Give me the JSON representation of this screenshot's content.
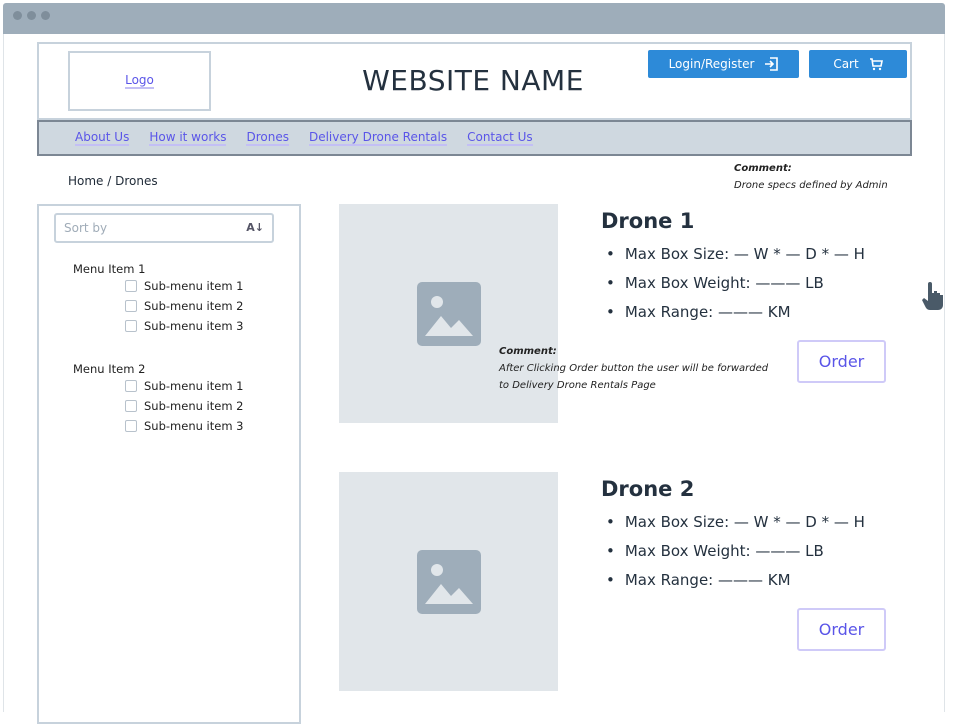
{
  "header": {
    "logo": "Logo",
    "site_name": "WEBSITE NAME",
    "login_label": "Login/Register",
    "cart_label": "Cart"
  },
  "nav": [
    "About Us",
    "How it works",
    "Drones",
    "Delivery Drone Rentals",
    "Contact Us"
  ],
  "breadcrumb": "Home / Drones",
  "comments": [
    {
      "title": "Comment:",
      "text": "Drone specs defined by Admin"
    },
    {
      "title": "Comment:",
      "line1": "After Clicking Order button the user will be forwarded",
      "line2": "to Delivery Drone Rentals Page"
    }
  ],
  "sidebar": {
    "sort_placeholder": "Sort by",
    "menus": [
      {
        "label": "Menu Item 1",
        "subs": [
          "Sub-menu item 1",
          "Sub-menu item 2",
          "Sub-menu item 3"
        ]
      },
      {
        "label": "Menu Item 2",
        "subs": [
          "Sub-menu item 1",
          "Sub-menu item 2",
          "Sub-menu item 3"
        ]
      }
    ]
  },
  "drones": [
    {
      "title": "Drone 1",
      "specs": [
        "Max Box Size: — W * — D * — H",
        "Max Box Weight: ——— LB",
        "Max Range: ——— KM"
      ],
      "order": "Order"
    },
    {
      "title": "Drone 2",
      "specs": [
        "Max Box Size: — W * — D * — H",
        "Max Box Weight: ——— LB",
        "Max Range: ——— KM"
      ],
      "order": "Order"
    }
  ]
}
